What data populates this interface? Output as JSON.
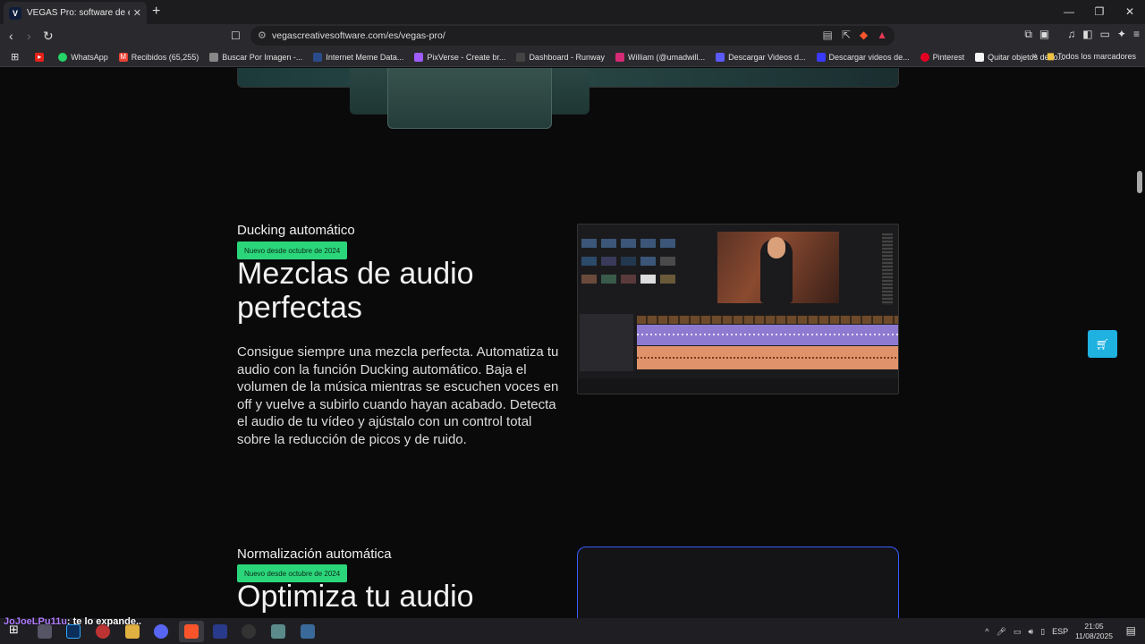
{
  "browser": {
    "tab_title": "VEGAS Pro: software de edición",
    "tab_favicon": "V",
    "new_tab": "+",
    "url": "vegascreativesoftware.com/es/vegas-pro/",
    "win_minimize": "—",
    "win_restore": "❐",
    "win_close": "✕"
  },
  "bookmarks": [
    {
      "label": "",
      "color": "#e62117",
      "icon": "youtube-icon"
    },
    {
      "label": "WhatsApp",
      "color": "#25d366",
      "icon": "whatsapp-icon"
    },
    {
      "label": "Recibidos (65,255)",
      "color": "#ea4335",
      "icon": "gmail-icon"
    },
    {
      "label": "Buscar Por Imagen -...",
      "color": "#888888",
      "icon": "globe-icon"
    },
    {
      "label": "Internet Meme Data...",
      "color": "#2b4c8a",
      "icon": "kym-icon"
    },
    {
      "label": "PixVerse - Create br...",
      "color": "#a05cff",
      "icon": "pixverse-icon"
    },
    {
      "label": "Dashboard - Runway",
      "color": "#444444",
      "icon": "runway-icon"
    },
    {
      "label": "William (@umadwill...",
      "color": "#d62976",
      "icon": "instagram-icon"
    },
    {
      "label": "Descargar Videos d...",
      "color": "#5a5aff",
      "icon": "download-icon"
    },
    {
      "label": "Descargar videos de...",
      "color": "#3a3aff",
      "icon": "download-icon"
    },
    {
      "label": "Pinterest",
      "color": "#e60023",
      "icon": "pinterest-icon"
    },
    {
      "label": "Quitar objetos de fo...",
      "color": "#f5f5f5",
      "icon": "page-icon"
    }
  ],
  "bookmarks_more": "»",
  "bookmarks_all": "Todos los marcadores",
  "section1": {
    "eyebrow": "Ducking automático",
    "badge": "Nuevo desde octubre de 2024",
    "title": "Mezclas de audio perfectas",
    "body": "Consigue siempre una mezcla perfecta. Automatiza tu audio con la función Ducking automático. Baja el volumen de la música mientras se escuchen voces en off y vuelve a subirlo cuando hayan acabado. Detecta el audio de tu vídeo y ajústalo con un control total sobre la reducción de picos y de ruido."
  },
  "section2": {
    "eyebrow": "Normalización automática",
    "badge": "Nuevo desde octubre de 2024",
    "title": "Optimiza tu audio"
  },
  "float_button_icon": "cart-icon",
  "chat": {
    "user": "JoJoeLPu11u",
    "message": ": te lo expande.."
  },
  "tray": {
    "lang": "ESP",
    "time": "21:05",
    "date": "11/08/2025"
  },
  "colors": {
    "accent_green": "#2bd67b",
    "accent_blue": "#3a5cff",
    "float_button": "#1fb1e0"
  }
}
